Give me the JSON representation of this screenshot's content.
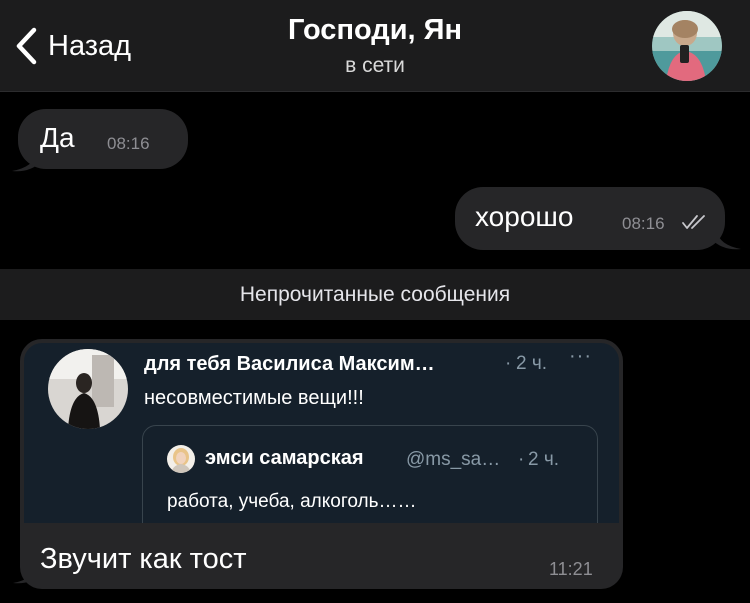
{
  "header": {
    "back_label": "Назад",
    "title": "Господи, Ян",
    "status": "в сети"
  },
  "messages": [
    {
      "direction": "incoming",
      "text": "Да",
      "time": "08:16"
    },
    {
      "direction": "outgoing",
      "text": "хорошо",
      "time": "08:16",
      "read": true
    }
  ],
  "unread_divider": "Непрочитанные сообщения",
  "shared_tweet": {
    "author": "для тебя Василиса Максим…",
    "separator": "·",
    "time": "2 ч.",
    "more": "···",
    "text": "несовместимые вещи!!!",
    "quote": {
      "author": "эмси самарская",
      "handle": "@ms_sa…",
      "separator": "·",
      "time": "2 ч.",
      "text": "работа, учеба, алкоголь……"
    }
  },
  "last_message": {
    "direction": "incoming",
    "text": "Звучит как тост",
    "time": "11:21"
  },
  "colors": {
    "background": "#000000",
    "header": "#1c1c1d",
    "bubble": "#262628",
    "tweet_card": "#15202b",
    "muted": "#8e8e93",
    "tweet_muted": "#8899a6"
  },
  "icons": {
    "back": "chevron-left-icon",
    "read_receipt": "double-check-icon",
    "more": "more-horizontal-icon"
  }
}
